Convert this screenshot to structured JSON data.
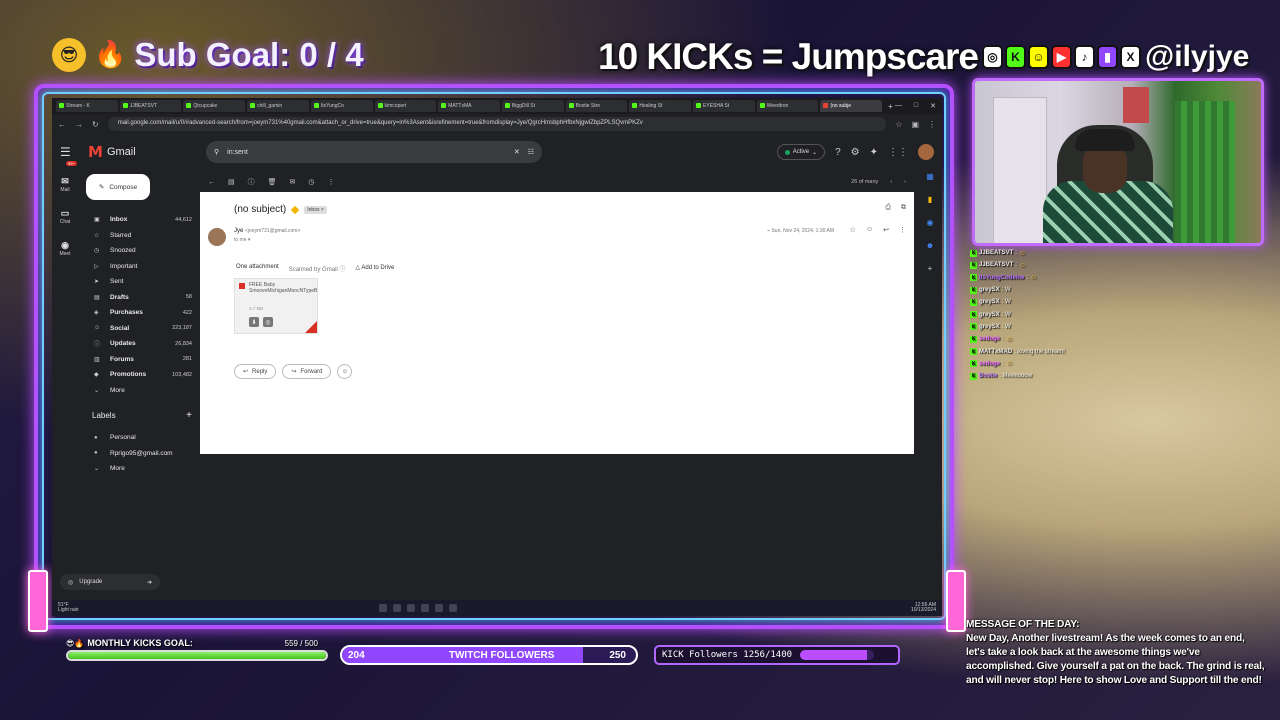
{
  "overlay": {
    "sub_goal": "Sub Goal: 0 / 4",
    "kicks_banner": "10 KICKs = Jumpscare",
    "handle": "@ilyjye",
    "social_icons": [
      "instagram-icon",
      "kick-icon",
      "snapchat-icon",
      "youtube-icon",
      "tiktok-icon",
      "twitch-icon",
      "x-icon"
    ],
    "monthly_kicks_label": "MONTHLY KICKS GOAL:",
    "monthly_kicks_value": "559 / 500",
    "monthly_kicks_progress": 1.0,
    "twitch_current": "204",
    "twitch_label": "TWITCH FOLLOWERS",
    "twitch_goal": "250",
    "twitch_progress": 0.82,
    "kick_followers": "KICK Followers 1256/1400",
    "kick_progress": 0.9,
    "motd_title": "MESSAGE OF THE DAY:",
    "motd_text": "New Day, Another livestream! As the week comes to an end, let's take a look back at the awesome things we've accomplished. Give yourself a pat on the back. The grind is real, and will never stop! Here to show Love and Support till the end!"
  },
  "browser": {
    "tabs": [
      {
        "label": "Stream - K",
        "color": "#53fc18"
      },
      {
        "label": "JJBEATSVT",
        "color": "#53fc18"
      },
      {
        "label": "Qtcupcake",
        "color": "#53fc18"
      },
      {
        "label": "chill_gamin",
        "color": "#53fc18"
      },
      {
        "label": "ItsYungCo",
        "color": "#53fc18"
      },
      {
        "label": "kimcopert",
        "color": "#53fc18"
      },
      {
        "label": "MATTxMA",
        "color": "#53fc18"
      },
      {
        "label": "BiggDill St",
        "color": "#53fc18"
      },
      {
        "label": "Bostie Stre",
        "color": "#53fc18"
      },
      {
        "label": "Healing St",
        "color": "#53fc18"
      },
      {
        "label": "EYESHA St",
        "color": "#53fc18"
      },
      {
        "label": "Weedtron",
        "color": "#53fc18"
      },
      {
        "label": "(no subje",
        "color": "#ea4335"
      }
    ],
    "url": "mail.google.com/mail/u/0/#advanced-search/from=joeym731%40gmail.com&attach_or_drive=true&query=in%3Asent&isrefinement=true&fromdisplay=Jye/QgrcHmsbphHfbxNjgwlZbpZPLSQvmPKZv"
  },
  "gmail": {
    "brand": "Gmail",
    "search_value": "in:sent",
    "status": "Active",
    "rail": [
      {
        "icon": "mail-icon",
        "label": "Mail",
        "badge": "99+"
      },
      {
        "icon": "chat-icon",
        "label": "Chat"
      },
      {
        "icon": "meet-icon",
        "label": "Meet"
      }
    ],
    "compose": "Compose",
    "nav": [
      {
        "icon": "inbox-icon",
        "glyph": "▣",
        "label": "Inbox",
        "count": "44,612"
      },
      {
        "icon": "star-icon",
        "glyph": "☆",
        "label": "Starred",
        "count": ""
      },
      {
        "icon": "clock-icon",
        "glyph": "◷",
        "label": "Snoozed",
        "count": ""
      },
      {
        "icon": "important-icon",
        "glyph": "▷",
        "label": "Important",
        "count": ""
      },
      {
        "icon": "send-icon",
        "glyph": "➤",
        "label": "Sent",
        "count": ""
      },
      {
        "icon": "draft-icon",
        "glyph": "▤",
        "label": "Drafts",
        "count": "58"
      },
      {
        "icon": "tag-icon",
        "glyph": "◈",
        "label": "Purchases",
        "count": "422"
      },
      {
        "icon": "people-icon",
        "glyph": "☺",
        "label": "Social",
        "count": "223,187"
      },
      {
        "icon": "info-icon",
        "glyph": "ⓘ",
        "label": "Updates",
        "count": "26,834"
      },
      {
        "icon": "forum-icon",
        "glyph": "▥",
        "label": "Forums",
        "count": "281"
      },
      {
        "icon": "promo-icon",
        "glyph": "◆",
        "label": "Promotions",
        "count": "103,482"
      },
      {
        "icon": "chevron-down-icon",
        "glyph": "⌄",
        "label": "More",
        "count": ""
      }
    ],
    "labels_title": "Labels",
    "labels": [
      {
        "label": "Personal",
        "color": "#c0c0c0"
      },
      {
        "label": "Rprigo95@gmail.com",
        "color": "#c0c0c0"
      }
    ],
    "labels_more": "More",
    "upgrade": "Upgrade",
    "paging": "26 of many",
    "email": {
      "subject": "(no subject)",
      "chip": "Inbox ×",
      "sender": "Jye",
      "sender_email": "<joeym731@gmail.com>",
      "to": "to me ▾",
      "date": "Sun, Nov 24, 2024, 1:30 AM",
      "attach_heading": "One attachment",
      "scanned": "Scanned by Gmail ⓘ",
      "add_drive": "Add to Drive",
      "file_name": "FREE Baby SmooveMichiganMoocNTypeBeatOMansion.m",
      "file_size": "4.7 MB",
      "reply": "Reply",
      "forward": "Forward"
    }
  },
  "taskbar": {
    "temp": "51°F",
    "weather": "Light rain",
    "time": "12:56 AM",
    "date": "10/13/2024"
  },
  "chat": [
    {
      "user": "JJBEATSVT",
      "color": "#e6e6e6",
      "text": ":",
      "emote": true
    },
    {
      "user": "JJBEATSVT",
      "color": "#e6e6e6",
      "text": ":",
      "emote": true
    },
    {
      "user": "ItsYungCodeine",
      "color": "#b06cff",
      "text": ":",
      "emote": true
    },
    {
      "user": "greySX",
      "color": "#e6e6e6",
      "text": ": W",
      "emote": false
    },
    {
      "user": "greySX",
      "color": "#e6e6e6",
      "text": ": W",
      "emote": false
    },
    {
      "user": "greySX",
      "color": "#e6e6e6",
      "text": ": W",
      "emote": false
    },
    {
      "user": "greySX",
      "color": "#e6e6e6",
      "text": ": W",
      "emote": false
    },
    {
      "user": "sedoge",
      "color": "#e86cff",
      "text": ":",
      "emote": true
    },
    {
      "user": "MATTxMAD",
      "color": "#e6e6e6",
      "text": ": loving the stream!",
      "emote": false
    },
    {
      "user": "sedoge",
      "color": "#e86cff",
      "text": ":",
      "emote": true
    },
    {
      "user": "Bostie",
      "color": "#c07cff",
      "text": ": Meeeooow",
      "emote": false
    }
  ]
}
